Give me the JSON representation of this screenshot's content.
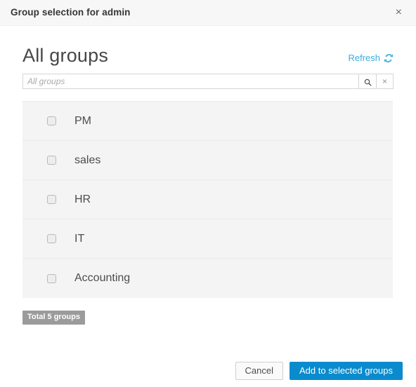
{
  "window": {
    "title": "Group selection for admin",
    "close_label": "×",
    "close_icon": "close-icon"
  },
  "content": {
    "heading": "All groups",
    "refresh": {
      "label": "Refresh",
      "icon": "refresh-icon",
      "color": "#3aaede"
    },
    "search": {
      "value": "",
      "placeholder": "All groups",
      "search_button_icon": "search-icon",
      "clear_button_icon": "clear-icon",
      "clear_button_label": "×"
    },
    "groups": [
      {
        "name": "PM",
        "checked": false
      },
      {
        "name": "sales",
        "checked": false
      },
      {
        "name": "HR",
        "checked": false
      },
      {
        "name": "IT",
        "checked": false
      },
      {
        "name": "Accounting",
        "checked": false
      }
    ],
    "total_badge": "Total 5 groups"
  },
  "footer": {
    "cancel_label": "Cancel",
    "submit_label": "Add to selected groups",
    "primary_color": "#0a8bcd"
  }
}
